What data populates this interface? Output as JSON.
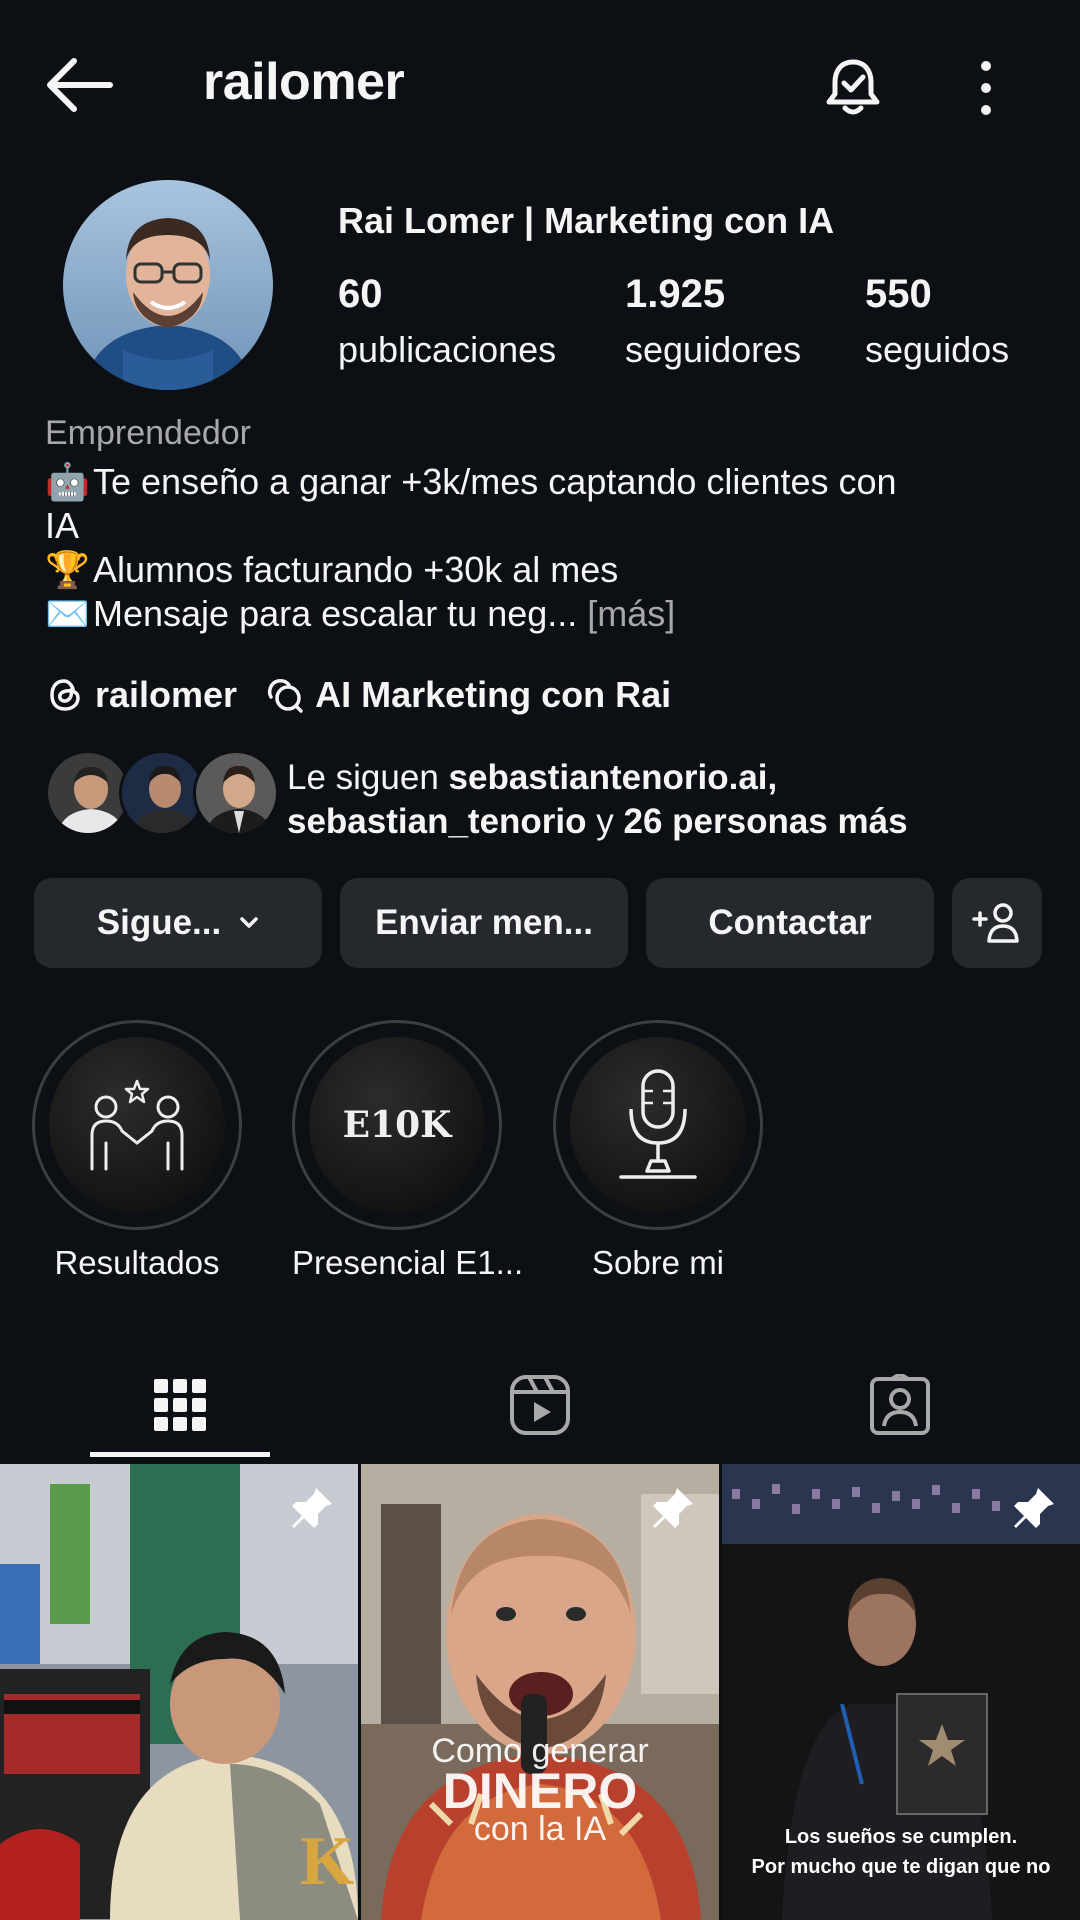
{
  "header": {
    "username": "railomer"
  },
  "profile": {
    "full_name": "Rai Lomer | Marketing con IA",
    "stats": [
      {
        "value": "60",
        "label": "publicaciones"
      },
      {
        "value": "1.925",
        "label": "seguidores"
      },
      {
        "value": "550",
        "label": "seguidos"
      }
    ],
    "category": "Emprendedor",
    "bio": {
      "line1": "Te enseño a ganar +3k/mes captando clientes con",
      "line1b": "IA",
      "line2": "Alumnos facturando +30k al mes",
      "line3": "Mensaje para escalar tu neg...",
      "more": "[más]"
    },
    "bio_emojis": {
      "line1": "🤖",
      "line2": "🏆",
      "line3": "✉️"
    },
    "links": {
      "threads": "railomer",
      "community": "AI Marketing con Rai"
    },
    "followed_by": {
      "prefix": "Le siguen ",
      "name1": "sebastiantenorio.ai,",
      "name2": "sebastian_tenorio",
      "middle": " y ",
      "others": "26 personas más"
    }
  },
  "actions": {
    "following": "Sigue...",
    "message": "Enviar men...",
    "contact": "Contactar"
  },
  "highlights": [
    {
      "label": "Resultados",
      "icon": "handshake-star-icon"
    },
    {
      "label": "Presencial E1...",
      "cover_text": "E10K"
    },
    {
      "label": "Sobre mi",
      "icon": "microphone-icon"
    }
  ],
  "tabs": [
    "grid-icon",
    "reels-icon",
    "tagged-icon"
  ],
  "posts": [
    {
      "pinned": true,
      "overlay_text": ""
    },
    {
      "pinned": true,
      "overlay_top": "Como generar",
      "overlay_mid": "DINERO",
      "overlay_bot": "con la IA"
    },
    {
      "pinned": true,
      "overlay_line1": "Los sueños se cumplen.",
      "overlay_line2": "Por mucho que te digan que no"
    }
  ],
  "colors": {
    "background": "#0c1014",
    "button": "#25292e",
    "muted_text": "#a8a8a8"
  }
}
